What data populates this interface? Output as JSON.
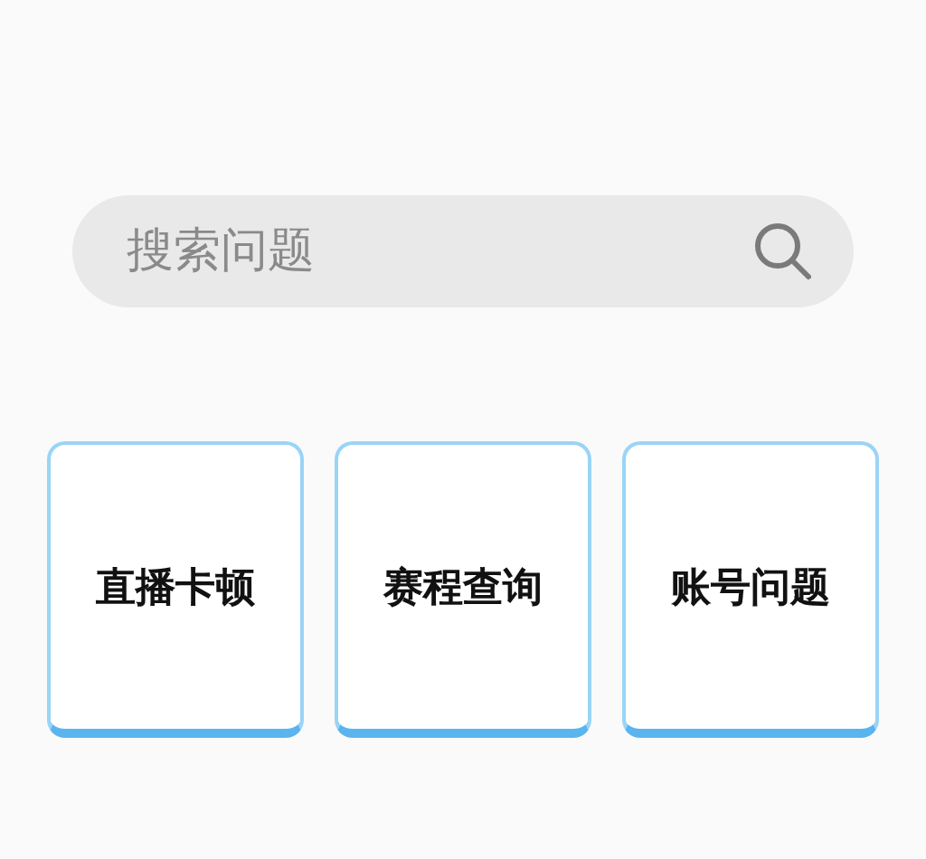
{
  "search": {
    "placeholder": "搜索问题"
  },
  "categories": [
    {
      "label": "直播卡顿"
    },
    {
      "label": "赛程查询"
    },
    {
      "label": "账号问题"
    }
  ]
}
